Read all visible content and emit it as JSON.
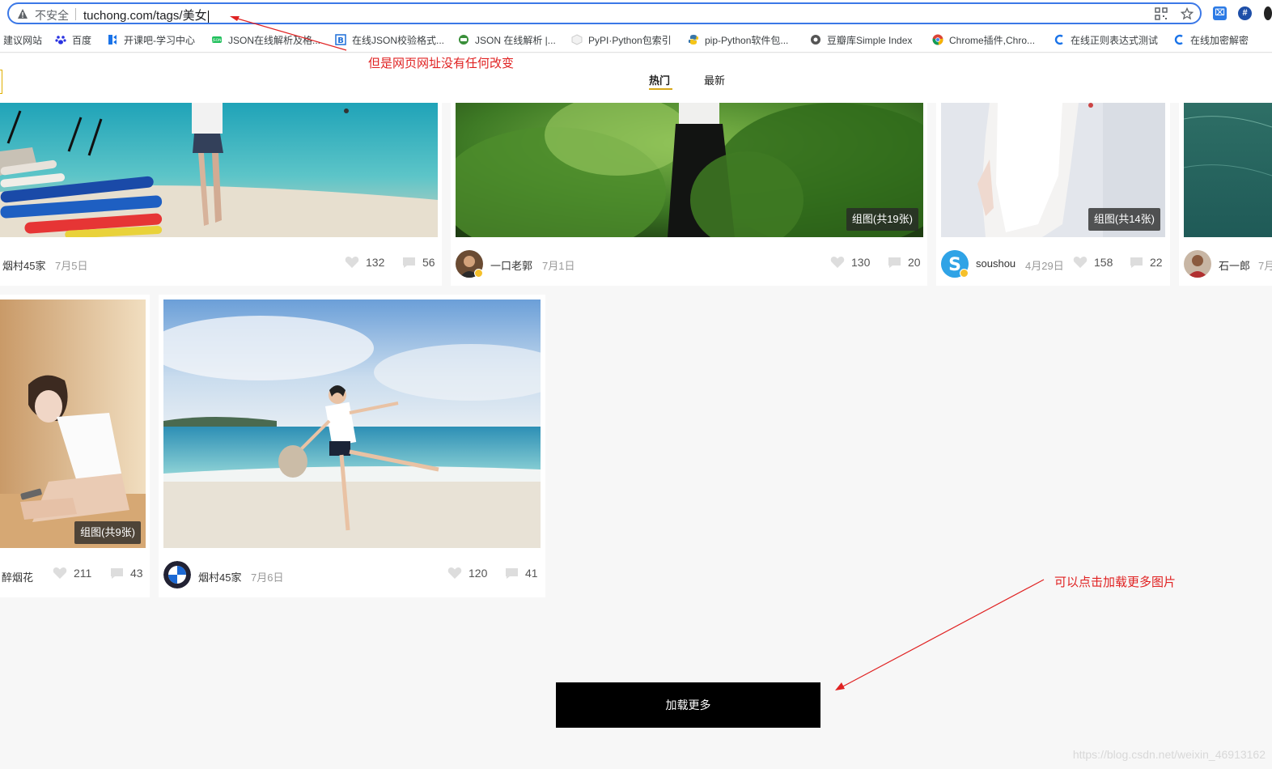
{
  "browser": {
    "security_label": "不安全",
    "url": "tuchong.com/tags/美女",
    "bookmarks": [
      {
        "label": "建议网站",
        "icon": "none"
      },
      {
        "label": "百度",
        "icon": "baidu-paw-icon"
      },
      {
        "label": "开课吧-学习中心",
        "icon": "kaikeba-icon"
      },
      {
        "label": "JSON在线解析及格...",
        "icon": "json-green-icon"
      },
      {
        "label": "在线JSON校验格式...",
        "icon": "bejson-b-icon"
      },
      {
        "label": "JSON 在线解析 |...",
        "icon": "json-globe-icon"
      },
      {
        "label": "PyPI·Python包索引",
        "icon": "pypi-cube-icon"
      },
      {
        "label": "pip-Python软件包...",
        "icon": "python-icon"
      },
      {
        "label": "豆瓣库Simple Index",
        "icon": "globe-icon"
      },
      {
        "label": "Chrome插件,Chro...",
        "icon": "chrome-icon"
      },
      {
        "label": "在线正则表达式测试",
        "icon": "c-blue-icon"
      },
      {
        "label": "在线加密解密",
        "icon": "c-blue-icon"
      }
    ]
  },
  "nav": {
    "tabs": [
      {
        "label": "热门",
        "active": true
      },
      {
        "label": "最新",
        "active": false
      }
    ]
  },
  "posts": [
    {
      "author": "烟村45家",
      "date": "7月5日",
      "likes": "132",
      "comments": "56",
      "badge": ""
    },
    {
      "author": "一口老郭",
      "date": "7月1日",
      "likes": "130",
      "comments": "20",
      "badge": "组图(共19张)"
    },
    {
      "author": "soushou",
      "date": "4月29日",
      "likes": "158",
      "comments": "22",
      "badge": "组图(共14张)"
    },
    {
      "author": "石一郎",
      "date": "7月",
      "likes": "",
      "comments": "",
      "badge": ""
    },
    {
      "author": "醉烟花",
      "date": "",
      "likes": "211",
      "comments": "43",
      "badge": "组图(共9张)"
    },
    {
      "author": "烟村45家",
      "date": "7月6日",
      "likes": "120",
      "comments": "41",
      "badge": ""
    }
  ],
  "load_more_label": "加载更多",
  "annotations": {
    "url_note": "但是网页网址没有任何改变",
    "load_note": "可以点击加载更多图片"
  },
  "watermark": "https://blog.csdn.net/weixin_46913162",
  "colors": {
    "annotation_red": "#e02222",
    "accent_underline": "#d7a81a",
    "address_border": "#3b78e7"
  }
}
